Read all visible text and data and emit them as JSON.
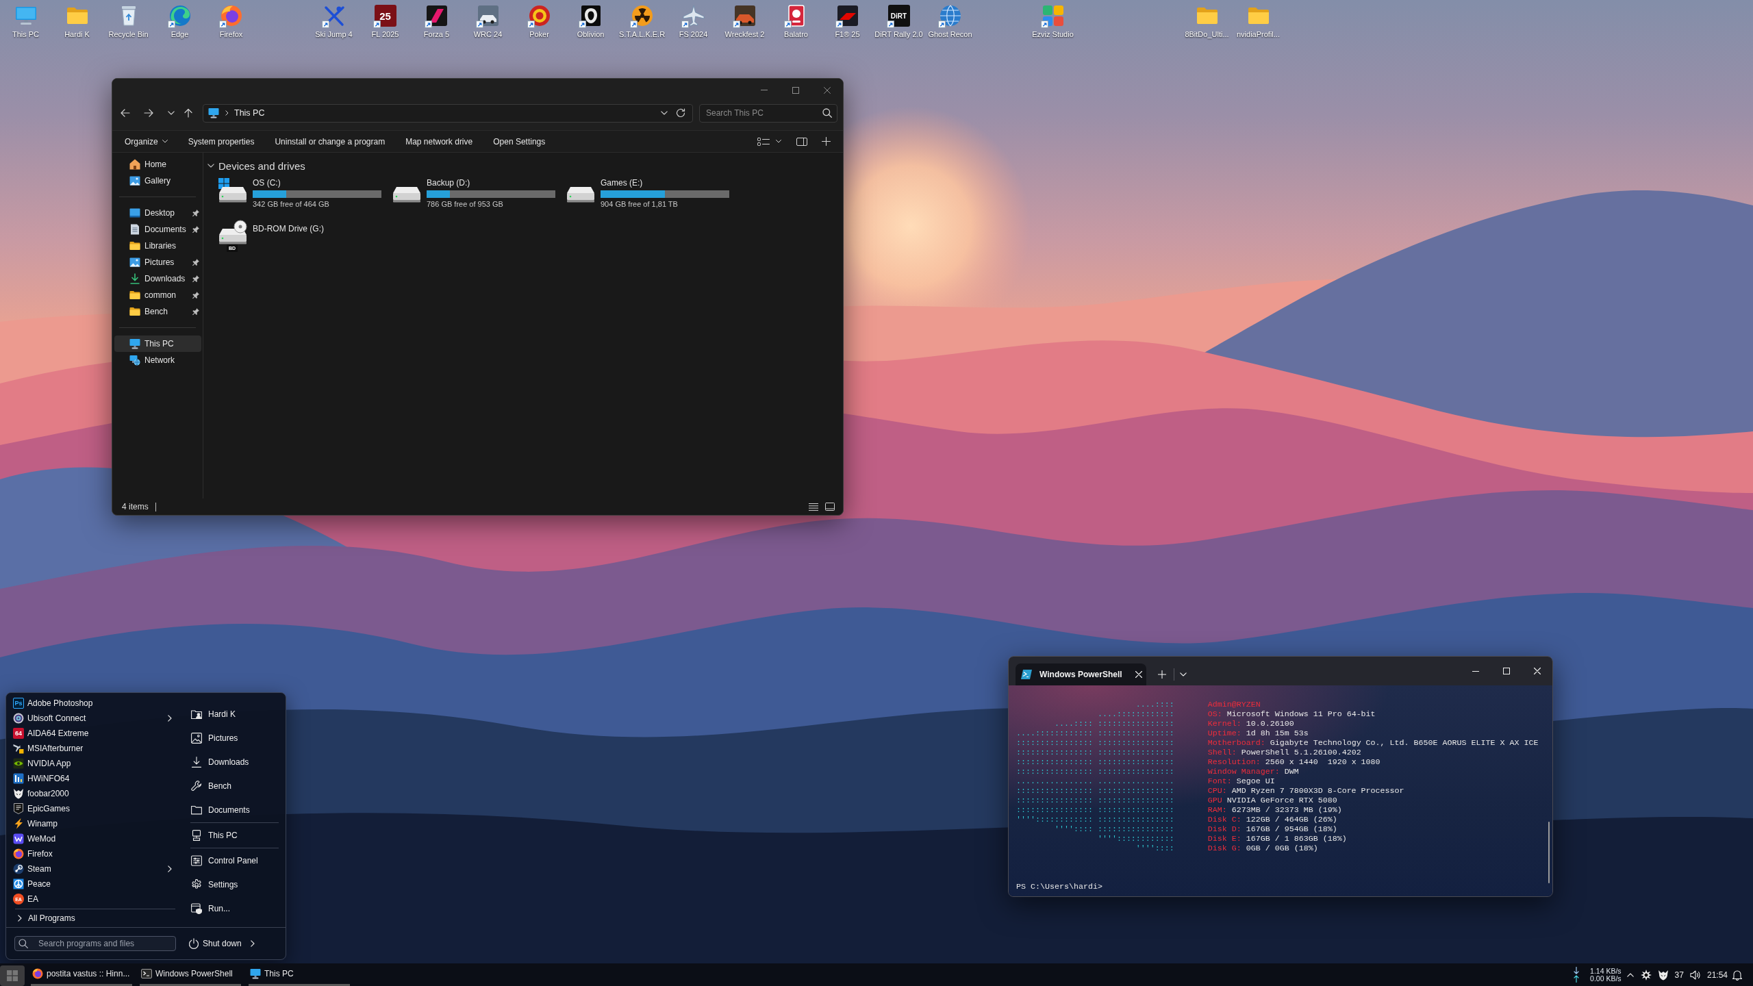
{
  "desktop": {
    "icons": [
      {
        "label": "This PC",
        "shortcut": false
      },
      {
        "label": "Hardi K",
        "shortcut": false
      },
      {
        "label": "Recycle Bin",
        "shortcut": false
      },
      {
        "label": "Edge",
        "shortcut": true
      },
      {
        "label": "Firefox",
        "shortcut": true
      },
      {
        "label": "Ski Jump 4",
        "shortcut": true
      },
      {
        "label": "FL 2025",
        "shortcut": true,
        "logo_text": "25"
      },
      {
        "label": "Forza 5",
        "shortcut": true
      },
      {
        "label": "WRC 24",
        "shortcut": true
      },
      {
        "label": "Poker",
        "shortcut": true
      },
      {
        "label": "Oblivion",
        "shortcut": true
      },
      {
        "label": "S.T.A.L.K.E.R",
        "shortcut": true
      },
      {
        "label": "FS 2024",
        "shortcut": true
      },
      {
        "label": "Wreckfest 2",
        "shortcut": true
      },
      {
        "label": "Balatro",
        "shortcut": true
      },
      {
        "label": "F1® 25",
        "shortcut": true
      },
      {
        "label": "DiRT Rally 2.0",
        "shortcut": true,
        "logo_text": "DiRT"
      },
      {
        "label": "Ghost Recon",
        "shortcut": true
      },
      {
        "label": "Ezviz Studio",
        "shortcut": true
      },
      {
        "label": "8BitDo_Ulti...",
        "shortcut": false
      },
      {
        "label": "nvidiaProfil...",
        "shortcut": false
      }
    ]
  },
  "explorer": {
    "address": {
      "path": "This PC"
    },
    "search": {
      "placeholder": "Search This PC"
    },
    "commands": [
      {
        "label": "Organize",
        "dropdown": true
      },
      {
        "label": "System properties",
        "dropdown": false
      },
      {
        "label": "Uninstall or change a program",
        "dropdown": false
      },
      {
        "label": "Map network drive",
        "dropdown": false
      },
      {
        "label": "Open Settings",
        "dropdown": false
      }
    ],
    "sidebar": [
      {
        "items": [
          {
            "label": "Home",
            "pinned": false,
            "selected": false
          },
          {
            "label": "Gallery",
            "pinned": false,
            "selected": false
          }
        ]
      },
      {
        "items": [
          {
            "label": "Desktop",
            "pinned": true,
            "selected": false
          },
          {
            "label": "Documents",
            "pinned": true,
            "selected": false
          },
          {
            "label": "Libraries",
            "pinned": false,
            "selected": false
          },
          {
            "label": "Pictures",
            "pinned": true,
            "selected": false
          },
          {
            "label": "Downloads",
            "pinned": true,
            "selected": false
          },
          {
            "label": "common",
            "pinned": true,
            "selected": false
          },
          {
            "label": "Bench",
            "pinned": true,
            "selected": false
          }
        ]
      },
      {
        "items": [
          {
            "label": "This PC",
            "pinned": false,
            "selected": true
          },
          {
            "label": "Network",
            "pinned": false,
            "selected": false
          }
        ]
      }
    ],
    "section": {
      "title": "Devices and drives",
      "expanded": true
    },
    "drives": [
      {
        "kind": "system",
        "name": "OS (C:)",
        "level": 0.26,
        "free": "342 GB free of 464 GB"
      },
      {
        "kind": "disk",
        "name": "Backup (D:)",
        "level": 0.18,
        "free": "786 GB free of 953 GB"
      },
      {
        "kind": "disk",
        "name": "Games (E:)",
        "level": 0.5,
        "free": "904 GB free of 1,81 TB"
      },
      {
        "kind": "optical",
        "name": "BD-ROM Drive (G:)",
        "media": "BD"
      }
    ],
    "status": "4 items"
  },
  "terminal": {
    "tab": "Windows PowerShell",
    "art": [
      "....::::",
      "....::::::::::::",
      "....:::: ::::::::::::::::",
      "....:::::::::::: ::::::::::::::::",
      ":::::::::::::::: ::::::::::::::::",
      ":::::::::::::::: ::::::::::::::::",
      ":::::::::::::::: ::::::::::::::::",
      ":::::::::::::::: ::::::::::::::::",
      "................ ................",
      ":::::::::::::::: ::::::::::::::::",
      ":::::::::::::::: ::::::::::::::::",
      ":::::::::::::::: ::::::::::::::::",
      "'''':::::::::::: ::::::::::::::::",
      "'''':::: ::::::::::::::::",
      "''''::::::::::::",
      "''''::::"
    ],
    "info": [
      {
        "label": "Admin@RYZEN"
      },
      {
        "label": "OS:",
        "value": "Microsoft Windows 11 Pro 64-bit"
      },
      {
        "label": "Kernel:",
        "value": "10.0.26100"
      },
      {
        "label": "Uptime:",
        "value": "1d 8h 15m 53s"
      },
      {
        "label": "Motherboard:",
        "value": "Gigabyte Technology Co., Ltd. B650E AORUS ELITE X AX ICE"
      },
      {
        "label": "Shell:",
        "value": "PowerShell 5.1.26100.4202"
      },
      {
        "label": "Resolution:",
        "value": "2560 x 1440  1920 x 1080"
      },
      {
        "label": "Window Manager:",
        "value": "DWM"
      },
      {
        "label": "Font:",
        "value": "Segoe UI"
      },
      {
        "label": "CPU:",
        "value": "AMD Ryzen 7 7800X3D 8-Core Processor"
      },
      {
        "label": "GPU",
        "value": "NVIDIA GeForce RTX 5080"
      },
      {
        "label": "RAM:",
        "value": "6273MB / 32373 MB (19%)"
      },
      {
        "label": "Disk C:",
        "value": "122GB / 464GB (26%)"
      },
      {
        "label": "Disk D:",
        "value": "167GB / 954GB (18%)"
      },
      {
        "label": "Disk E:",
        "value": "167GB / 1 863GB (18%)"
      },
      {
        "label": "Disk G:",
        "value": "0GB / 0GB (18%)"
      }
    ],
    "prompt": "PS C:\\Users\\hardi>"
  },
  "start_menu": {
    "programs": [
      {
        "label": "Adobe Photoshop",
        "submenu": false,
        "logo_text": "Ps"
      },
      {
        "label": "Ubisoft Connect",
        "submenu": true
      },
      {
        "label": "AIDA64 Extreme",
        "submenu": false,
        "logo_text": "64"
      },
      {
        "label": "MSIAfterburner",
        "submenu": false
      },
      {
        "label": "NVIDIA App",
        "submenu": false
      },
      {
        "label": "HWiNFO64",
        "submenu": false
      },
      {
        "label": "foobar2000",
        "submenu": false
      },
      {
        "label": "EpicGames",
        "submenu": false
      },
      {
        "label": "Winamp",
        "submenu": false
      },
      {
        "label": "WeMod",
        "submenu": false
      },
      {
        "label": "Firefox",
        "submenu": false
      },
      {
        "label": "Steam",
        "submenu": true
      },
      {
        "label": "Peace",
        "submenu": false
      },
      {
        "label": "EA",
        "submenu": false,
        "logo_text": "EA"
      }
    ],
    "all_programs": "All Programs",
    "places": [
      {
        "items": [
          {
            "label": "Hardi K"
          },
          {
            "label": "Pictures"
          },
          {
            "label": "Downloads"
          },
          {
            "label": "Bench"
          },
          {
            "label": "Documents"
          }
        ]
      },
      {
        "items": [
          {
            "label": "This PC"
          }
        ]
      },
      {
        "items": [
          {
            "label": "Control Panel"
          },
          {
            "label": "Settings"
          },
          {
            "label": "Run..."
          }
        ]
      }
    ],
    "search": {
      "placeholder": "Search programs and files"
    },
    "shutdown": "Shut down"
  },
  "taskbar": {
    "start_open": true,
    "windows": [
      {
        "label": "postita vastus :: Hinn..."
      },
      {
        "label": "Windows PowerShell"
      },
      {
        "label": "This PC"
      }
    ],
    "tray": {
      "download_speed": "1.14 KB/s",
      "upload_speed": "0.00 KB/s",
      "indicator": "37",
      "clock": "21:54"
    }
  }
}
